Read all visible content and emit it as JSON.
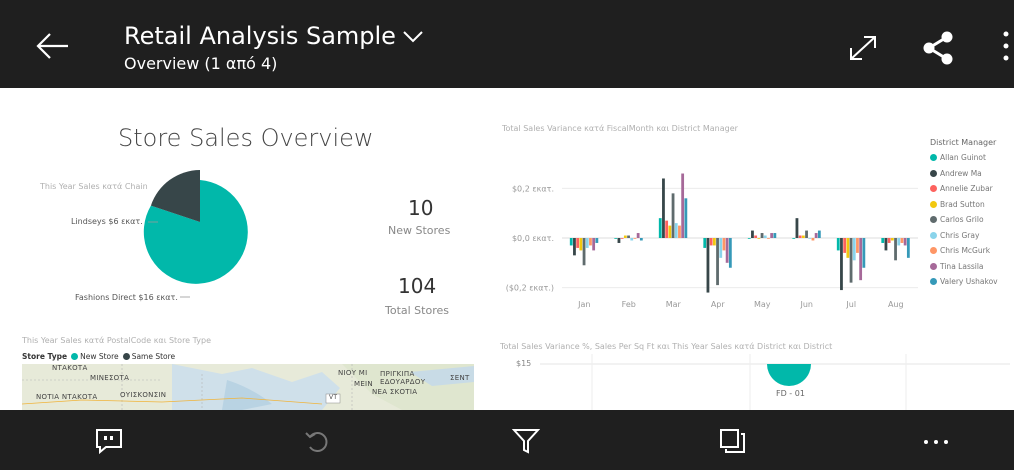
{
  "header": {
    "title": "Retail Analysis Sample",
    "subtitle": "Overview (1 από 4)"
  },
  "tile_store_sales": {
    "title": "Store Sales Overview"
  },
  "pie": {
    "title": "This Year Sales κατά Chain",
    "slice_labels": [
      "Lindseys $6 εκατ.",
      "Fashions Direct $16 εκατ."
    ],
    "colors": {
      "Lindseys": "#374649",
      "Fashions Direct": "#01b8aa"
    }
  },
  "kpis": [
    {
      "value": "10",
      "label": "New Stores"
    },
    {
      "value": "104",
      "label": "Total Stores"
    }
  ],
  "variance_chart": {
    "title": "Total Sales Variance κατά FiscalMonth και District Manager",
    "legend_title": "District Manager"
  },
  "chart_data": {
    "type": "bar",
    "title": "Total Sales Variance κατά FiscalMonth και District Manager",
    "categories": [
      "Jan",
      "Feb",
      "Mar",
      "Apr",
      "May",
      "Jun",
      "Jul",
      "Aug"
    ],
    "ytick_labels": [
      "$0,2 εκατ.",
      "$0,0 εκατ.",
      "($0,2 εκατ.)"
    ],
    "ylim": [
      -0.25,
      0.25
    ],
    "series": [
      {
        "name": "Allan Guinot",
        "color": "#01b8aa",
        "values": [
          -0.03,
          0.0,
          0.08,
          -0.04,
          0.0,
          0.0,
          -0.05,
          -0.02
        ]
      },
      {
        "name": "Andrew Ma",
        "color": "#374649",
        "values": [
          -0.07,
          -0.02,
          0.24,
          -0.22,
          0.03,
          0.08,
          -0.21,
          -0.05
        ]
      },
      {
        "name": "Annelie Zubar",
        "color": "#fd625e",
        "values": [
          -0.04,
          0.0,
          0.07,
          -0.03,
          0.01,
          0.01,
          -0.06,
          -0.02
        ]
      },
      {
        "name": "Brad Sutton",
        "color": "#f2c80f",
        "values": [
          -0.05,
          0.01,
          0.05,
          -0.03,
          0.0,
          0.01,
          -0.08,
          -0.01
        ]
      },
      {
        "name": "Carlos Grilo",
        "color": "#5f6b6d",
        "values": [
          -0.11,
          0.01,
          0.18,
          -0.19,
          0.02,
          0.03,
          -0.18,
          -0.09
        ]
      },
      {
        "name": "Chris Gray",
        "color": "#8ad4eb",
        "values": [
          -0.04,
          -0.01,
          0.06,
          -0.08,
          0.01,
          0.0,
          -0.09,
          -0.03
        ]
      },
      {
        "name": "Chris McGurk",
        "color": "#fe9666",
        "values": [
          -0.03,
          0.0,
          0.05,
          -0.05,
          0.0,
          -0.01,
          -0.06,
          -0.02
        ]
      },
      {
        "name": "Tina Lassila",
        "color": "#a66999",
        "values": [
          -0.05,
          0.02,
          0.26,
          -0.1,
          0.02,
          0.02,
          -0.17,
          -0.03
        ]
      },
      {
        "name": "Valery Ushakov",
        "color": "#3599b8",
        "values": [
          -0.02,
          -0.01,
          0.16,
          -0.12,
          0.02,
          0.03,
          -0.12,
          -0.08
        ]
      }
    ]
  },
  "scatter_tile": {
    "title": "Total Sales Variance %, Sales Per Sq Ft και This Year Sales κατά District και District",
    "y_tick": "$15",
    "point_label": "FD - 01",
    "point_color": "#01b8aa"
  },
  "map_tile": {
    "title": "This Year Sales κατά PostalCode και Store Type",
    "legend_title": "Store Type",
    "legend_items": [
      {
        "label": "New Store",
        "color": "#01b8aa"
      },
      {
        "label": "Same Store",
        "color": "#374649"
      }
    ],
    "map_labels": [
      "ΝΤΑΚΟΤΑ",
      "ΜΙΝΕΣΟΤΑ",
      "ΝΟΤΙΑ ΝΤΑΚΟΤΑ",
      "ΟΥΙΣΚΟΝΣΙΝ",
      "ΝΙΟΥ ΜΙ",
      "ΠΡΙΓΚΙΠΑ ΕΔΟΥΑΡΔΟΥ",
      "ΣΕΝΤ",
      "ΜΕΙΝ",
      "ΝΕΑ ΣΚΟΤΙΑ",
      "VT"
    ]
  },
  "bottombar": {
    "icons": [
      "comment-icon",
      "undo-icon",
      "filter-icon",
      "pages-icon",
      "more-icon"
    ]
  }
}
